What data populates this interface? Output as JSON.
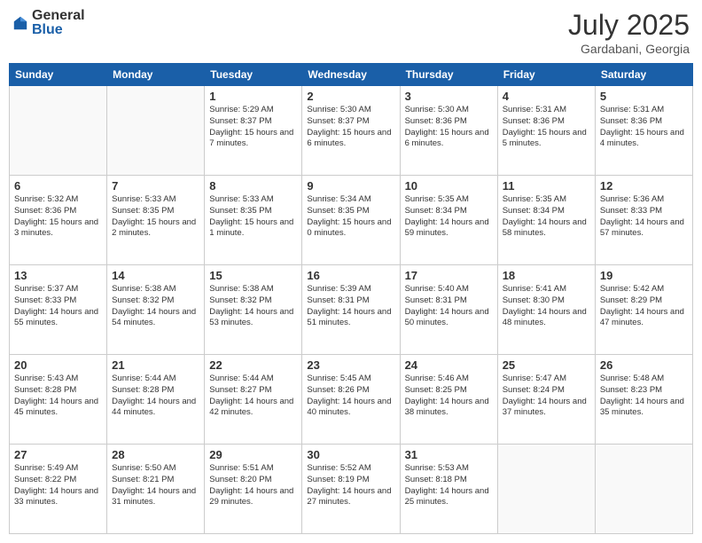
{
  "header": {
    "logo_general": "General",
    "logo_blue": "Blue",
    "month_year": "July 2025",
    "location": "Gardabani, Georgia"
  },
  "days_of_week": [
    "Sunday",
    "Monday",
    "Tuesday",
    "Wednesday",
    "Thursday",
    "Friday",
    "Saturday"
  ],
  "weeks": [
    [
      {
        "day": "",
        "info": ""
      },
      {
        "day": "",
        "info": ""
      },
      {
        "day": "1",
        "info": "Sunrise: 5:29 AM\nSunset: 8:37 PM\nDaylight: 15 hours and 7 minutes."
      },
      {
        "day": "2",
        "info": "Sunrise: 5:30 AM\nSunset: 8:37 PM\nDaylight: 15 hours and 6 minutes."
      },
      {
        "day": "3",
        "info": "Sunrise: 5:30 AM\nSunset: 8:36 PM\nDaylight: 15 hours and 6 minutes."
      },
      {
        "day": "4",
        "info": "Sunrise: 5:31 AM\nSunset: 8:36 PM\nDaylight: 15 hours and 5 minutes."
      },
      {
        "day": "5",
        "info": "Sunrise: 5:31 AM\nSunset: 8:36 PM\nDaylight: 15 hours and 4 minutes."
      }
    ],
    [
      {
        "day": "6",
        "info": "Sunrise: 5:32 AM\nSunset: 8:36 PM\nDaylight: 15 hours and 3 minutes."
      },
      {
        "day": "7",
        "info": "Sunrise: 5:33 AM\nSunset: 8:35 PM\nDaylight: 15 hours and 2 minutes."
      },
      {
        "day": "8",
        "info": "Sunrise: 5:33 AM\nSunset: 8:35 PM\nDaylight: 15 hours and 1 minute."
      },
      {
        "day": "9",
        "info": "Sunrise: 5:34 AM\nSunset: 8:35 PM\nDaylight: 15 hours and 0 minutes."
      },
      {
        "day": "10",
        "info": "Sunrise: 5:35 AM\nSunset: 8:34 PM\nDaylight: 14 hours and 59 minutes."
      },
      {
        "day": "11",
        "info": "Sunrise: 5:35 AM\nSunset: 8:34 PM\nDaylight: 14 hours and 58 minutes."
      },
      {
        "day": "12",
        "info": "Sunrise: 5:36 AM\nSunset: 8:33 PM\nDaylight: 14 hours and 57 minutes."
      }
    ],
    [
      {
        "day": "13",
        "info": "Sunrise: 5:37 AM\nSunset: 8:33 PM\nDaylight: 14 hours and 55 minutes."
      },
      {
        "day": "14",
        "info": "Sunrise: 5:38 AM\nSunset: 8:32 PM\nDaylight: 14 hours and 54 minutes."
      },
      {
        "day": "15",
        "info": "Sunrise: 5:38 AM\nSunset: 8:32 PM\nDaylight: 14 hours and 53 minutes."
      },
      {
        "day": "16",
        "info": "Sunrise: 5:39 AM\nSunset: 8:31 PM\nDaylight: 14 hours and 51 minutes."
      },
      {
        "day": "17",
        "info": "Sunrise: 5:40 AM\nSunset: 8:31 PM\nDaylight: 14 hours and 50 minutes."
      },
      {
        "day": "18",
        "info": "Sunrise: 5:41 AM\nSunset: 8:30 PM\nDaylight: 14 hours and 48 minutes."
      },
      {
        "day": "19",
        "info": "Sunrise: 5:42 AM\nSunset: 8:29 PM\nDaylight: 14 hours and 47 minutes."
      }
    ],
    [
      {
        "day": "20",
        "info": "Sunrise: 5:43 AM\nSunset: 8:28 PM\nDaylight: 14 hours and 45 minutes."
      },
      {
        "day": "21",
        "info": "Sunrise: 5:44 AM\nSunset: 8:28 PM\nDaylight: 14 hours and 44 minutes."
      },
      {
        "day": "22",
        "info": "Sunrise: 5:44 AM\nSunset: 8:27 PM\nDaylight: 14 hours and 42 minutes."
      },
      {
        "day": "23",
        "info": "Sunrise: 5:45 AM\nSunset: 8:26 PM\nDaylight: 14 hours and 40 minutes."
      },
      {
        "day": "24",
        "info": "Sunrise: 5:46 AM\nSunset: 8:25 PM\nDaylight: 14 hours and 38 minutes."
      },
      {
        "day": "25",
        "info": "Sunrise: 5:47 AM\nSunset: 8:24 PM\nDaylight: 14 hours and 37 minutes."
      },
      {
        "day": "26",
        "info": "Sunrise: 5:48 AM\nSunset: 8:23 PM\nDaylight: 14 hours and 35 minutes."
      }
    ],
    [
      {
        "day": "27",
        "info": "Sunrise: 5:49 AM\nSunset: 8:22 PM\nDaylight: 14 hours and 33 minutes."
      },
      {
        "day": "28",
        "info": "Sunrise: 5:50 AM\nSunset: 8:21 PM\nDaylight: 14 hours and 31 minutes."
      },
      {
        "day": "29",
        "info": "Sunrise: 5:51 AM\nSunset: 8:20 PM\nDaylight: 14 hours and 29 minutes."
      },
      {
        "day": "30",
        "info": "Sunrise: 5:52 AM\nSunset: 8:19 PM\nDaylight: 14 hours and 27 minutes."
      },
      {
        "day": "31",
        "info": "Sunrise: 5:53 AM\nSunset: 8:18 PM\nDaylight: 14 hours and 25 minutes."
      },
      {
        "day": "",
        "info": ""
      },
      {
        "day": "",
        "info": ""
      }
    ]
  ]
}
